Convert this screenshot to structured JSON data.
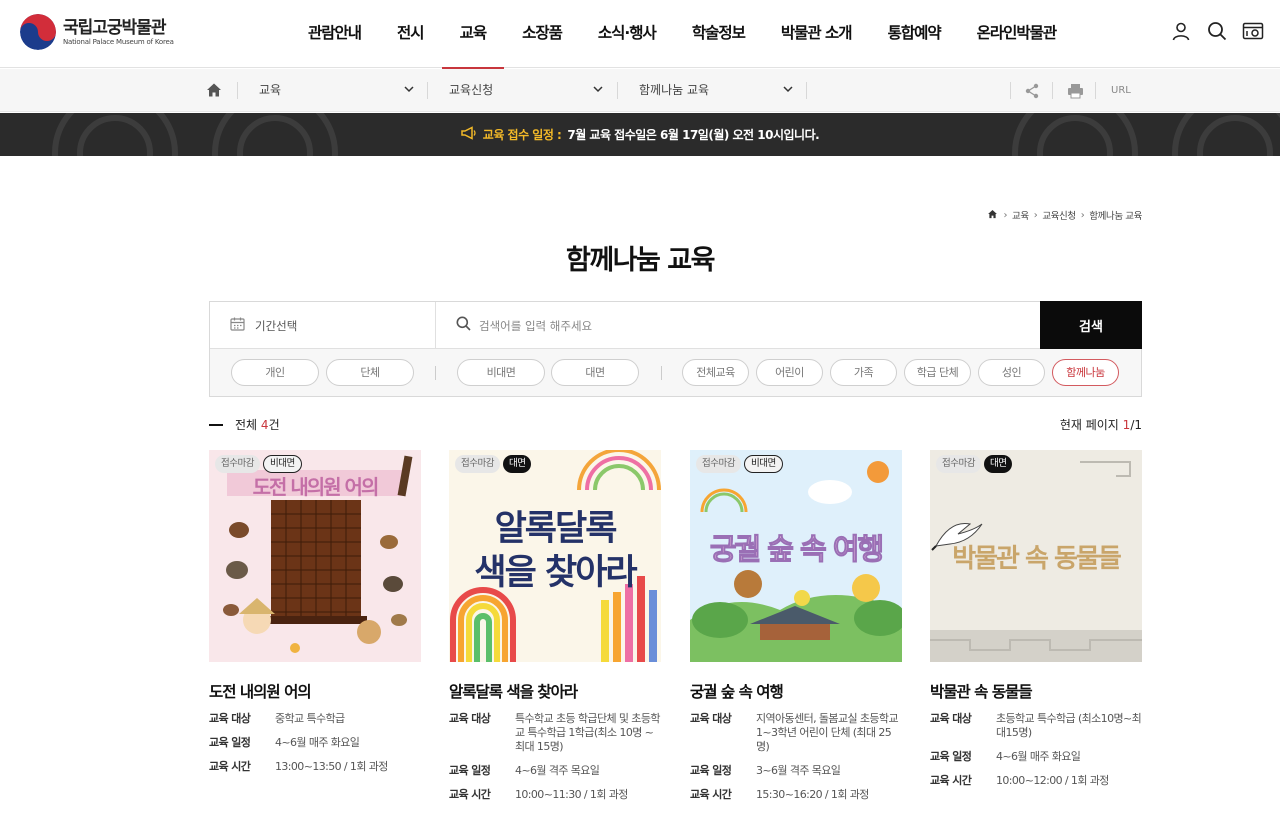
{
  "header": {
    "logo_ko": "국립고궁박물관",
    "logo_en": "National Palace Museum of Korea",
    "nav": [
      "관람안내",
      "전시",
      "교육",
      "소장품",
      "소식·행사",
      "학술정보",
      "박물관 소개",
      "통합예약",
      "온라인박물관"
    ],
    "active_nav": "교육"
  },
  "locbar": {
    "dd1": "교육",
    "dd2": "교육신청",
    "dd3": "함께나눔 교육",
    "url": "URL"
  },
  "notice": {
    "label": "교육 접수 일정 :",
    "text": "7월 교육 접수일은 6월 17일(월) 오전 10시입니다."
  },
  "breadcrumb": [
    "교육",
    "교육신청",
    "함께나눔 교육"
  ],
  "page_title": "함께나눔 교육",
  "search": {
    "date_label": "기간선택",
    "placeholder": "검색어를 입력 해주세요",
    "button": "검색"
  },
  "filters": {
    "group1": [
      "개인",
      "단체"
    ],
    "group2": [
      "비대면",
      "대면"
    ],
    "group3": [
      "전체교육",
      "어린이",
      "가족",
      "학급 단체",
      "성인",
      "함께나눔"
    ],
    "active": "함께나눔"
  },
  "count": {
    "label": "전체",
    "num": "4",
    "unit": "건"
  },
  "pageinfo": {
    "label": "현재 페이지",
    "cur": "1",
    "total": "/1"
  },
  "info_labels": {
    "target": "교육 대상",
    "schedule": "교육 일정",
    "time": "교육 시간"
  },
  "cards": [
    {
      "status": "접수마감",
      "mode": "비대면",
      "thumb_text": "도전 내의원 어의",
      "title": "도전 내의원 어의",
      "target": "중학교 특수학급",
      "schedule": "4~6월 매주 화요일",
      "time": "13:00~13:50 / 1회 과정"
    },
    {
      "status": "접수마감",
      "mode": "대면",
      "thumb_text_1": "알록달록",
      "thumb_text_2": "색을 찾아라",
      "title": "알록달록 색을 찾아라",
      "target": "특수학교 초등 학급단체 및 초등학교 특수학급 1학급(최소 10명 ~ 최대 15명)",
      "schedule": "4~6월 격주 목요일",
      "time": "10:00~11:30 / 1회 과정"
    },
    {
      "status": "접수마감",
      "mode": "비대면",
      "thumb_text": "궁궐 숲 속 여행",
      "title": "궁궐 숲 속 여행",
      "target": "지역아동센터, 돌봄교실 초등학교 1~3학년 어린이 단체 (최대 25명)",
      "schedule": "3~6월 격주 목요일",
      "time": "15:30~16:20 / 1회 과정"
    },
    {
      "status": "접수마감",
      "mode": "대면",
      "thumb_text": "박물관 속 동물들",
      "title": "박물관 속 동물들",
      "target": "초등학교 특수학급 (최소10명~최대15명)",
      "schedule": "4~6월 매주 화요일",
      "time": "10:00~12:00 / 1회 과정"
    }
  ],
  "colors": {
    "accent": "#c9363c",
    "notice_label": "#f3b928",
    "notice_bg": "#2b2b2b"
  }
}
